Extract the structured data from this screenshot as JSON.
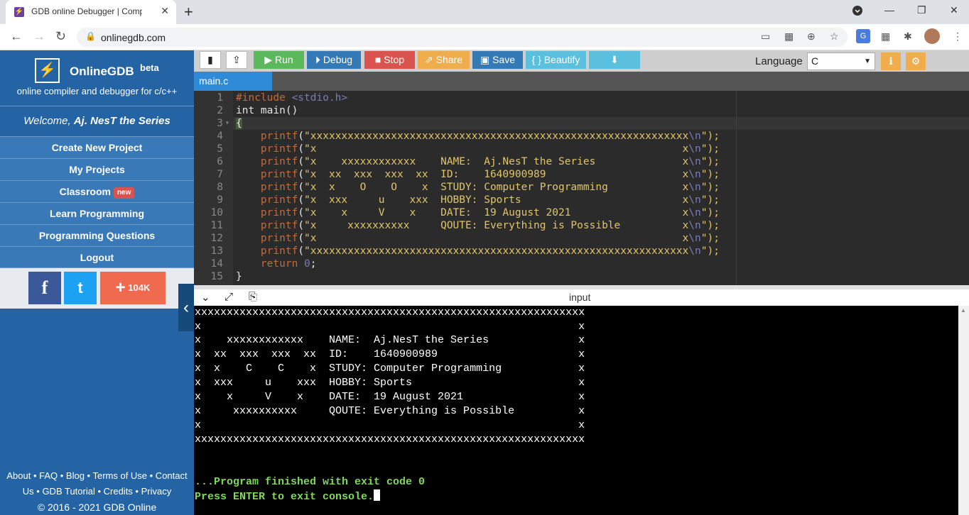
{
  "browser": {
    "tab_title": "GDB online Debugger | Compiler",
    "url": "onlinegdb.com"
  },
  "sidebar": {
    "brand_name": "OnlineGDB",
    "brand_badge": "beta",
    "tagline": "online compiler and debugger for c/c++",
    "welcome_prefix": "Welcome, ",
    "welcome_user": "Aj. NesT the Series",
    "menu": [
      {
        "label": "Create New Project"
      },
      {
        "label": "My Projects"
      },
      {
        "label": "Classroom",
        "badge": "new"
      },
      {
        "label": "Learn Programming"
      },
      {
        "label": "Programming Questions"
      },
      {
        "label": "Logout"
      }
    ],
    "social": {
      "facebook": "f",
      "twitter": "t",
      "share_count": "104K"
    },
    "footer": {
      "line1": "About • FAQ • Blog • Terms of Use • Contact",
      "line2": "Us • GDB Tutorial • Credits • Privacy",
      "line3": "© 2016 - 2021 GDB Online"
    }
  },
  "toolbar": {
    "run": "Run",
    "debug": "Debug",
    "stop": "Stop",
    "share": "Share",
    "save": "Save",
    "beautify": "{ } Beautify",
    "language_label": "Language",
    "language_value": "C",
    "colors": {
      "run": "#5cb85c",
      "debug": "#337ab7",
      "stop": "#d9534f",
      "share": "#f0ad4e",
      "save": "#337ab7",
      "beautify": "#5bc0de",
      "download": "#5bc0de"
    }
  },
  "editor": {
    "file_tab": "main.c",
    "lines": [
      {
        "n": "1"
      },
      {
        "n": "2"
      },
      {
        "n": "3"
      },
      {
        "n": "4"
      },
      {
        "n": "5"
      },
      {
        "n": "6"
      },
      {
        "n": "7"
      },
      {
        "n": "8"
      },
      {
        "n": "9"
      },
      {
        "n": "10"
      },
      {
        "n": "11"
      },
      {
        "n": "12"
      },
      {
        "n": "13"
      },
      {
        "n": "14"
      },
      {
        "n": "15"
      }
    ],
    "code": {
      "l1_directive": "#include",
      "l1_header": "<stdio.h>",
      "l2": "int main()",
      "l3": "{",
      "printf": "printf",
      "s4": "\"xxxxxxxxxxxxxxxxxxxxxxxxxxxxxxxxxxxxxxxxxxxxxxxxxxxxxxxxxxxxx",
      "s5": "\"x                                                           x",
      "s6": "\"x    xxxxxxxxxxxx    NAME:  Aj.NesT the Series              x",
      "s7": "\"x  xx  xxx  xxx  xx  ID:    1640900989                      x",
      "s8": "\"x  x    O    O    x  STUDY: Computer Programming            x",
      "s9": "\"x  xxx     u    xxx  HOBBY: Sports                          x",
      "s10": "\"x    x     V    x    DATE:  19 August 2021                  x",
      "s11": "\"x     xxxxxxxxxx     QOUTE: Everything is Possible          x",
      "s12": "\"x                                                           x",
      "s13": "\"xxxxxxxxxxxxxxxxxxxxxxxxxxxxxxxxxxxxxxxxxxxxxxxxxxxxxxxxxxxxx",
      "esc": "\\n",
      "tail": "\");",
      "l14_kw": "return",
      "l14_num": "0",
      "l15": "}"
    }
  },
  "console": {
    "title": "input",
    "lines": [
      "xxxxxxxxxxxxxxxxxxxxxxxxxxxxxxxxxxxxxxxxxxxxxxxxxxxxxxxxxxxxx",
      "x                                                           x",
      "x    xxxxxxxxxxxx    NAME:  Aj.NesT the Series              x",
      "x  xx  xxx  xxx  xx  ID:    1640900989                      x",
      "x  x    C    C    x  STUDY: Computer Programming            x",
      "x  xxx     u    xxx  HOBBY: Sports                          x",
      "x    x     V    x    DATE:  19 August 2021                  x",
      "x     xxxxxxxxxx     QOUTE: Everything is Possible          x",
      "x                                                           x",
      "xxxxxxxxxxxxxxxxxxxxxxxxxxxxxxxxxxxxxxxxxxxxxxxxxxxxxxxxxxxxx"
    ],
    "finished": "...Program finished with exit code 0",
    "prompt": "Press ENTER to exit console."
  }
}
